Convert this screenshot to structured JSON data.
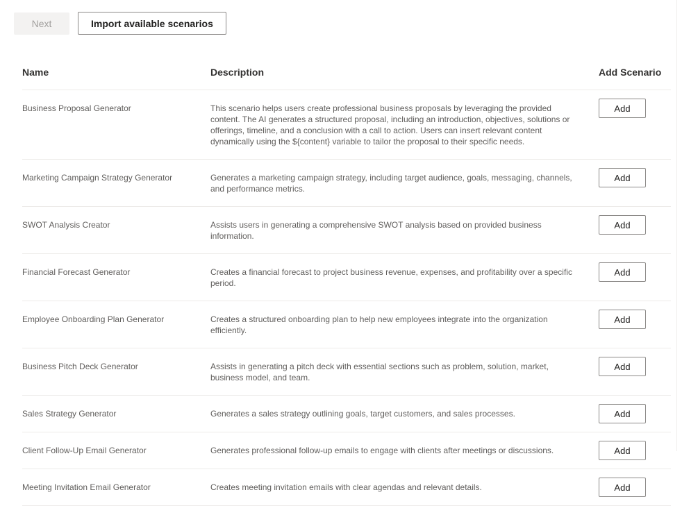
{
  "toolbar": {
    "next_label": "Next",
    "import_label": "Import available scenarios"
  },
  "table": {
    "headers": {
      "name": "Name",
      "description": "Description",
      "action": "Add Scenario"
    },
    "add_label": "Add",
    "rows": [
      {
        "name": "Business Proposal Generator",
        "description": "This scenario helps users create professional business proposals by leveraging the provided content. The AI generates a structured proposal, including an introduction, objectives, solutions or offerings, timeline, and a conclusion with a call to action. Users can insert relevant content dynamically using the ${content} variable to tailor the proposal to their specific needs.",
        "action": "Add"
      },
      {
        "name": "Marketing Campaign Strategy Generator",
        "description": "Generates a marketing campaign strategy, including target audience, goals, messaging, channels, and performance metrics.",
        "action": "Add"
      },
      {
        "name": "SWOT Analysis Creator",
        "description": "Assists users in generating a comprehensive SWOT analysis based on provided business information.",
        "action": "Add"
      },
      {
        "name": "Financial Forecast Generator",
        "description": "Creates a financial forecast to project business revenue, expenses, and profitability over a specific period.",
        "action": "Add"
      },
      {
        "name": "Employee Onboarding Plan Generator",
        "description": "Creates a structured onboarding plan to help new employees integrate into the organization efficiently.",
        "action": "Add"
      },
      {
        "name": "Business Pitch Deck Generator",
        "description": "Assists in generating a pitch deck with essential sections such as problem, solution, market, business model, and team.",
        "action": "Add"
      },
      {
        "name": "Sales Strategy Generator",
        "description": "Generates a sales strategy outlining goals, target customers, and sales processes.",
        "action": "Add"
      },
      {
        "name": "Client Follow-Up Email Generator",
        "description": "Generates professional follow-up emails to engage with clients after meetings or discussions.",
        "action": "Add"
      },
      {
        "name": "Meeting Invitation Email Generator",
        "description": "Creates meeting invitation emails with clear agendas and relevant details.",
        "action": "Add"
      }
    ]
  },
  "colors": {
    "header_text": "#323130",
    "body_text": "#605e5c",
    "divider": "#edebe9",
    "button_border": "#8a8886",
    "disabled_bg": "#f3f2f1",
    "disabled_text": "#a19f9d"
  }
}
